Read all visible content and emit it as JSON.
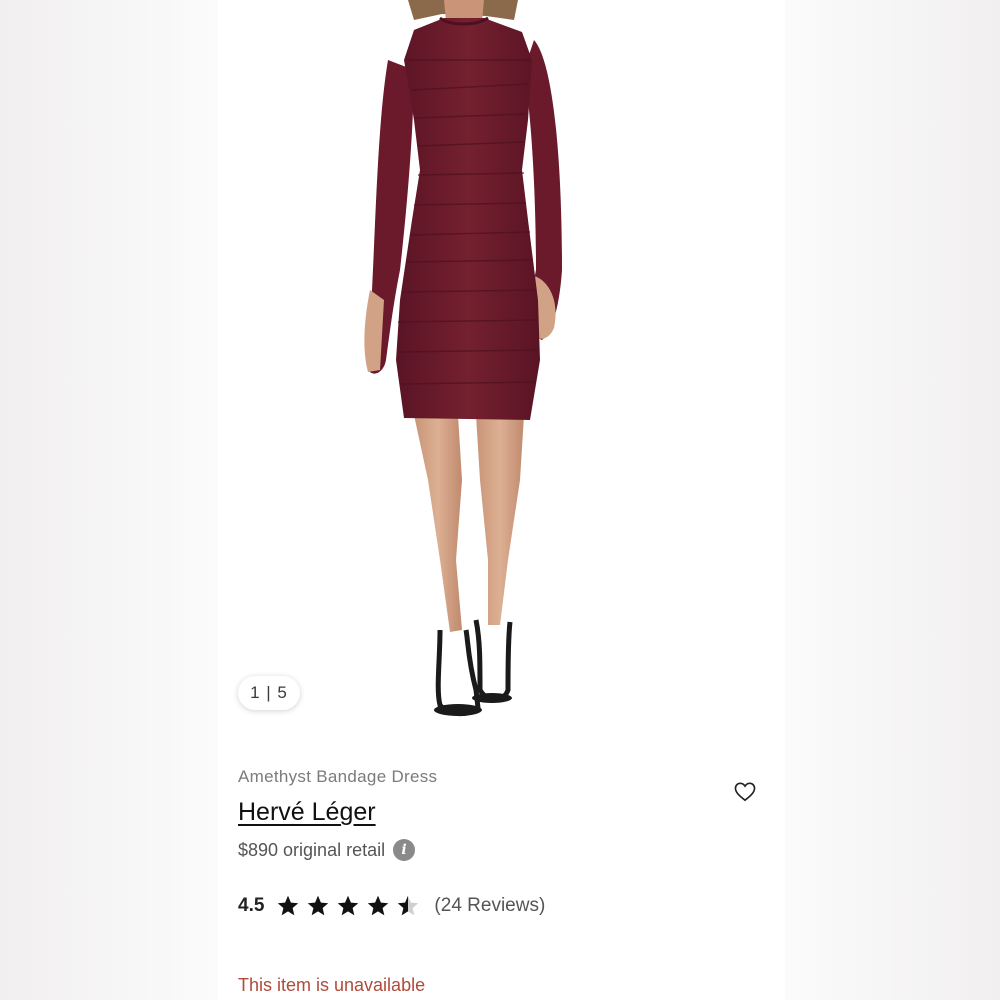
{
  "gallery": {
    "counter": "1 | 5"
  },
  "product": {
    "name": "Amethyst Bandage Dress",
    "brand": "Hervé Léger",
    "retail_price": "$890 original retail",
    "rating": "4.5",
    "rating_value": 4.5,
    "rating_max": 5,
    "reviews": "(24 Reviews)",
    "availability": "This item is unavailable"
  },
  "icons": {
    "wishlist": "heart-outline-icon",
    "info": "info-icon",
    "star": "star-icon"
  },
  "colors": {
    "dress": "#6b1a2c",
    "unavailable_text": "#b04a3a",
    "text_primary": "#111111",
    "text_secondary": "#7b7b7b"
  }
}
